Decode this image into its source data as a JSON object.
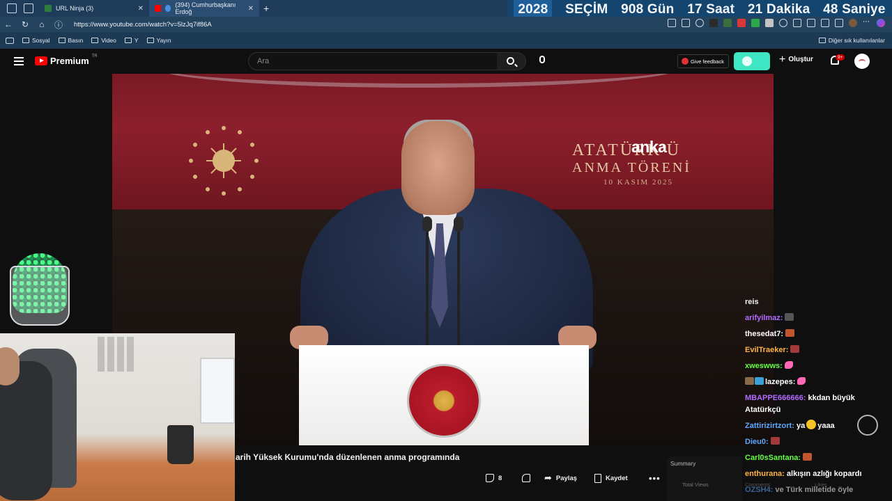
{
  "browser": {
    "tabs": [
      {
        "label": "URL Ninja (3)",
        "favicon_color": "#2f7d3a",
        "active": false
      },
      {
        "label": "(394) Cumhurbaşkanı Erdoğ",
        "favicon_color": "#ff0000",
        "active": true
      }
    ],
    "url": "https://www.youtube.com/watch?v=5lzJq7if86A",
    "bookmarks": [
      "Sosyal",
      "Basın",
      "Video",
      "Y",
      "Yayın"
    ],
    "other_bookmarks": "Diğer sık kullanılanlar"
  },
  "countdown": {
    "year": "2028",
    "election": "SEÇİM",
    "days": "908 Gün",
    "hours": "17 Saat",
    "minutes": "21 Dakika",
    "seconds": "48 Saniye"
  },
  "youtube": {
    "logo_text": "Premium",
    "logo_country": "TR",
    "search_placeholder": "Ara",
    "feedback_label": "Give feedback",
    "create_label": "Oluştur",
    "notif_badge": "9+",
    "accent": "#ff0000"
  },
  "video": {
    "banner_title": "ATATÜRK'Ü",
    "banner_sub": "ANMA TÖRENİ",
    "banner_date": "10 KASIM 2025",
    "broadcaster": "anka",
    "title_visible": "arih Yüksek Kurumu'nda düzenlenen anma programında",
    "likes": "8",
    "share_label": "Paylaş",
    "save_label": "Kaydet",
    "summary_label": "Summary",
    "total_views_label": "Total Views",
    "comments_label": "Comments",
    "likes_label": "Likes"
  },
  "chat": [
    {
      "user": "",
      "user_color": "#ffffff",
      "msg": "reis"
    },
    {
      "user": "arifyilmaz:",
      "user_color": "#b36bff",
      "msg": "",
      "emote": "#555"
    },
    {
      "user": "thesedat7:",
      "user_color": "#ffffff",
      "msg": "",
      "emote": "#c0552e"
    },
    {
      "user": "EvilTraeker:",
      "user_color": "#ffb347",
      "msg": "",
      "emote": "#a33a3a"
    },
    {
      "user": "xweswws:",
      "user_color": "#66ff44",
      "msg": "",
      "fish": true
    },
    {
      "user": "lazepes:",
      "user_color": "#ffffff",
      "msg": "",
      "fish": true,
      "prefix": true
    },
    {
      "user": "MBAPPE666666:",
      "user_color": "#b36bff",
      "msg": "kkdan büyük Atatürkçü",
      "wrap": true
    },
    {
      "user": "Zattirizirtzort:",
      "user_color": "#5fa8ff",
      "msg": "ya",
      "after": "yaaa",
      "smile": true
    },
    {
      "user": "Dieu0:",
      "user_color": "#5fa8ff",
      "msg": "",
      "emote": "#a33a3a"
    },
    {
      "user": "Carl0sSantana:",
      "user_color": "#66ff44",
      "msg": "",
      "emote": "#c0552e"
    },
    {
      "user": "enthurana:",
      "user_color": "#ffb347",
      "msg": "alkışın azlığı kopardı"
    },
    {
      "user": "OZSH4:",
      "user_color": "#5fa8ff",
      "msg": "ve Türk milletide öyle"
    }
  ]
}
